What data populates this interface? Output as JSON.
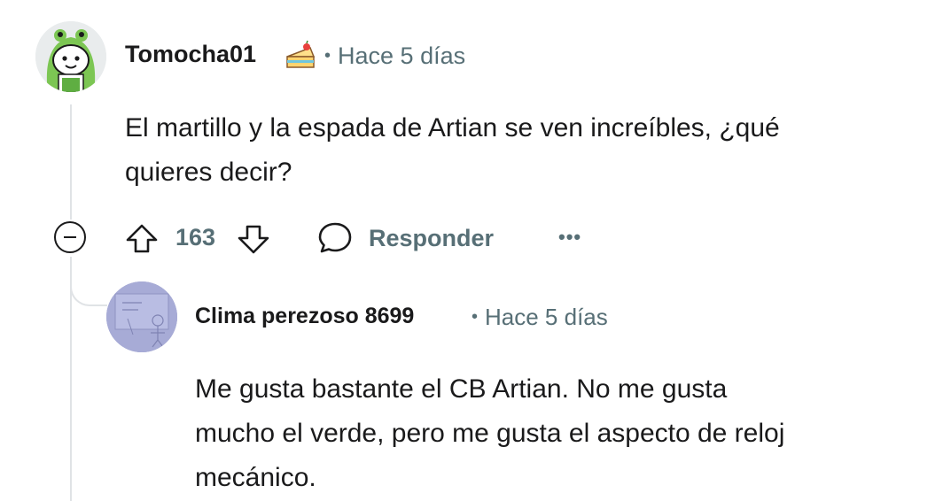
{
  "comment": {
    "author": "Tomocha01",
    "badge_icon": "cake-icon",
    "separator": "•",
    "time": "Hace 5 días",
    "body_lines": [
      "El martillo y la espada de Artian se ven increíbles, ¿qué",
      "quieres decir?"
    ],
    "actions": {
      "score": "163",
      "reply_label": "Responder",
      "more_label": "•••"
    }
  },
  "reply": {
    "author": "Clima perezoso 8699",
    "separator": "•",
    "time": "Hace 5 días",
    "body_lines": [
      "Me gusta bastante el CB Artian. No me gusta",
      "mucho el verde, pero me gusta el aspecto de reloj",
      "mecánico."
    ]
  },
  "colors": {
    "text_primary": "#1a1a1b",
    "text_meta": "#576f76",
    "thread_line": "#e0e3e6",
    "avatar_green": "#6fc34a"
  }
}
